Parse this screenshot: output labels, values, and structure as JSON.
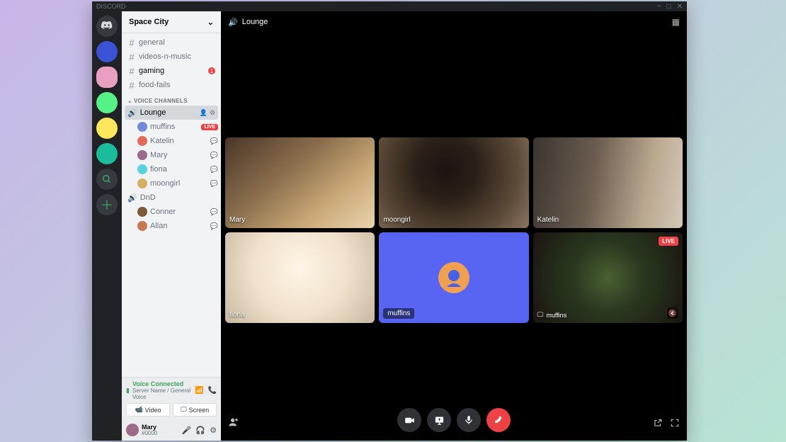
{
  "titlebar": {
    "app_name": "DISCORD"
  },
  "server": {
    "name": "Space City"
  },
  "text_channels": [
    {
      "name": "general",
      "active": false,
      "badge": null
    },
    {
      "name": "videos-n-music",
      "active": false,
      "badge": null
    },
    {
      "name": "gaming",
      "active": true,
      "badge": "1"
    },
    {
      "name": "food-fails",
      "active": false,
      "badge": null
    }
  ],
  "voice_section_label": "VOICE CHANNELS",
  "voice_channels": [
    {
      "name": "Lounge",
      "selected": true,
      "members": [
        {
          "name": "muffins",
          "live": true,
          "badge_text": "LIVE"
        },
        {
          "name": "Katelin",
          "live": false
        },
        {
          "name": "Mary",
          "live": false
        },
        {
          "name": "fiona",
          "live": false
        },
        {
          "name": "moongirl",
          "live": false
        }
      ]
    },
    {
      "name": "DnD",
      "selected": false,
      "members": [
        {
          "name": "Conner",
          "live": false
        },
        {
          "name": "Allan",
          "live": false
        }
      ]
    }
  ],
  "voice_panel": {
    "status_label": "Voice Connected",
    "sub_label": "Server Name / General Voice",
    "video_btn": "Video",
    "screen_btn": "Screen"
  },
  "user": {
    "name": "Mary",
    "tag": "#0000"
  },
  "call": {
    "channel_name": "Lounge",
    "tiles": [
      {
        "label": "Mary",
        "style": "tag",
        "live": false,
        "muted": false,
        "streaming": false
      },
      {
        "label": "moongirl",
        "style": "tag",
        "live": false,
        "muted": false,
        "streaming": false
      },
      {
        "label": "Katelin",
        "style": "tag",
        "live": false,
        "muted": false,
        "streaming": false
      },
      {
        "label": "fiona",
        "style": "tag",
        "live": false,
        "muted": false,
        "streaming": false
      },
      {
        "label": "muffins",
        "style": "chip",
        "live": false,
        "muted": false,
        "streaming": false,
        "avatar_only": true
      },
      {
        "label": "muffins",
        "style": "stream",
        "live": true,
        "live_text": "LIVE",
        "muted": true,
        "streaming": true
      }
    ]
  }
}
